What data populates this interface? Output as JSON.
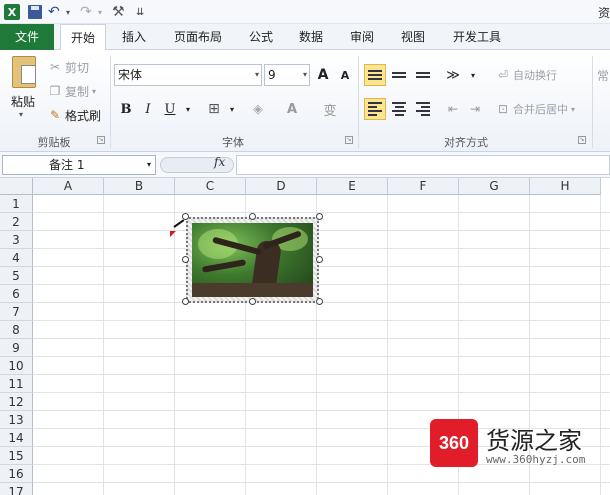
{
  "window": {
    "title": "资"
  },
  "quick_access": {
    "logo": "X",
    "undo": "↶",
    "redo": "↷",
    "dropdown": "▾",
    "tools": "⚒",
    "customize": "⇊"
  },
  "tabs": [
    "文件",
    "开始",
    "插入",
    "页面布局",
    "公式",
    "数据",
    "审阅",
    "视图",
    "开发工具"
  ],
  "ribbon": {
    "clipboard": {
      "paste": "粘贴",
      "cut": "剪切",
      "copy": "复制",
      "format_painter": "格式刷",
      "label": "剪贴板"
    },
    "font": {
      "name": "宋体",
      "size": "9",
      "grow": "A",
      "shrink": "A",
      "bold": "B",
      "italic": "I",
      "underline": "U",
      "font_color": "A",
      "phonetic": "变",
      "label": "字体"
    },
    "alignment": {
      "wrap": "自动换行",
      "merge": "合并后居中",
      "label": "对齐方式"
    },
    "number": {
      "label": "常"
    }
  },
  "formula_bar": {
    "name_box": "备注 1",
    "fx": "fx",
    "value": ""
  },
  "grid": {
    "columns": [
      "A",
      "B",
      "C",
      "D",
      "E",
      "F",
      "G",
      "H"
    ],
    "rows": [
      "1",
      "2",
      "3",
      "4",
      "5",
      "6",
      "7",
      "8",
      "9",
      "10",
      "11",
      "12",
      "13",
      "14",
      "15",
      "16",
      "17"
    ]
  },
  "watermark": {
    "badge": "360",
    "name": "货源之家",
    "url": "www.360hyzj.com"
  }
}
